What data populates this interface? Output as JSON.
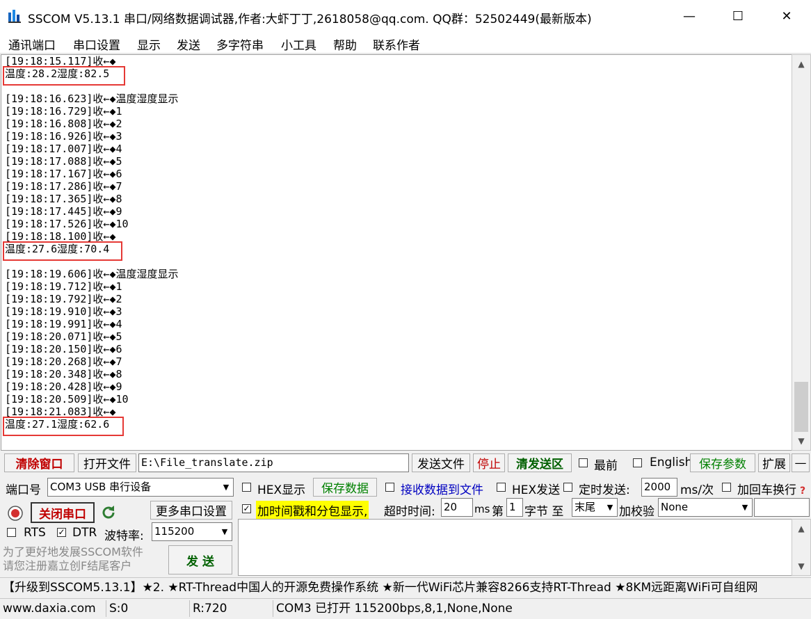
{
  "window": {
    "title": "SSCOM V5.13.1 串口/网络数据调试器,作者:大虾丁丁,2618058@qq.com. QQ群：52502449(最新版本)",
    "minimize": "—",
    "maximize": "☐",
    "close": "✕"
  },
  "menu": [
    "通讯端口",
    "串口设置",
    "显示",
    "发送",
    "多字符串",
    "小工具",
    "帮助",
    "联系作者"
  ],
  "receive": {
    "lines": [
      "[19:18:15.117]收←◆",
      "温度:28.2湿度:82.5",
      "",
      "[19:18:16.623]收←◆温度湿度显示",
      "[19:18:16.729]收←◆1",
      "[19:18:16.808]收←◆2",
      "[19:18:16.926]收←◆3",
      "[19:18:17.007]收←◆4",
      "[19:18:17.088]收←◆5",
      "[19:18:17.167]收←◆6",
      "[19:18:17.286]收←◆7",
      "[19:18:17.365]收←◆8",
      "[19:18:17.445]收←◆9",
      "[19:18:17.526]收←◆10",
      "[19:18:18.100]收←◆",
      "温度:27.6湿度:70.4",
      "",
      "[19:18:19.606]收←◆温度湿度显示",
      "[19:18:19.712]收←◆1",
      "[19:18:19.792]收←◆2",
      "[19:18:19.910]收←◆3",
      "[19:18:19.991]收←◆4",
      "[19:18:20.071]收←◆5",
      "[19:18:20.150]收←◆6",
      "[19:18:20.268]收←◆7",
      "[19:18:20.348]收←◆8",
      "[19:18:20.428]收←◆9",
      "[19:18:20.509]收←◆10",
      "[19:18:21.083]收←◆",
      "温度:27.1湿度:62.6"
    ]
  },
  "toolbar1": {
    "clear_window": "清除窗口",
    "open_file": "打开文件",
    "file_path": "E:\\File_translate.zip",
    "send_file": "发送文件",
    "stop": "停止",
    "clear_send": "清发送区",
    "topmost": "最前",
    "english": "English",
    "save_params": "保存参数",
    "expand": "扩展",
    "collapse": "—"
  },
  "port": {
    "port_label": "端口号",
    "port_value": "COM3 USB 串行设备",
    "close_port": "关闭串口",
    "more_settings": "更多串口设置",
    "rts": "RTS",
    "dtr": "DTR",
    "baud_label": "波特率:",
    "baud_value": "115200"
  },
  "options": {
    "hex_display": "HEX显示",
    "save_data": "保存数据",
    "recv_to_file": "接收数据到文件",
    "hex_send": "HEX发送",
    "timed_send": "定时发送:",
    "interval": "2000",
    "interval_unit": "ms/次",
    "add_crlf": "加回车换行",
    "timestamp": "加时间戳和分包显示,",
    "timeout_label": "超时时间:",
    "timeout_value": "20",
    "timeout_unit": "ms",
    "byte_prefix": "第",
    "byte_value": "1",
    "byte_label": "字节 至",
    "end_value": "末尾",
    "checksum_label": "加校验",
    "checksum_value": "None"
  },
  "promo": {
    "line1": "为了更好地发展SSCOM软件",
    "line2": "请您注册嘉立创F结尾客户",
    "send": "发  送"
  },
  "marquee": "【升级到SSCOM5.13.1】★2. ★RT-Thread中国人的开源免费操作系统 ★新一代WiFi芯片兼容8266支持RT-Thread ★8KM远距离WiFi可自组网",
  "status": {
    "site": "www.daxia.com",
    "sent": "S:0",
    "received": "R:720",
    "port_state": "COM3 已打开  115200bps,8,1,None,None"
  },
  "colors": {
    "highlight_box": "#e53935",
    "clear_window_text": "#c00000",
    "stop_text": "#c00000",
    "clear_send_text": "#006000",
    "save_params_text": "#008000",
    "timestamp_bg": "#ffff00",
    "recv_to_file_text": "#0000c0"
  }
}
